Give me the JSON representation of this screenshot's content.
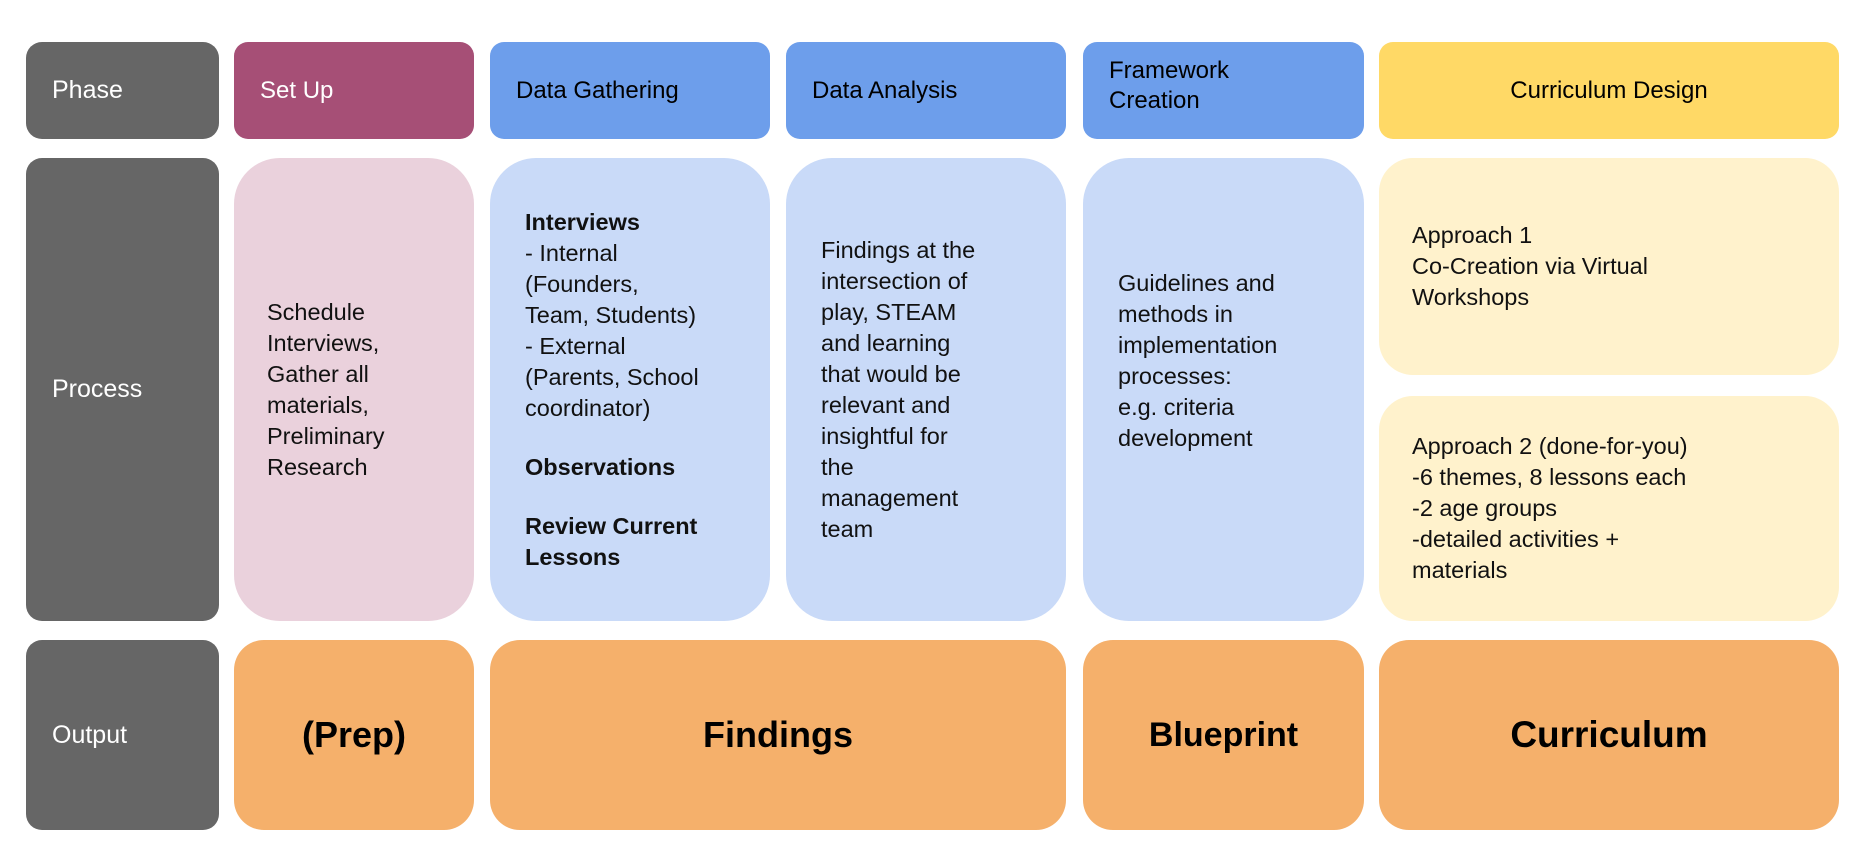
{
  "colors": {
    "label": "#666666",
    "setup": "#A64F76",
    "blue_header": "#6D9EEB",
    "yellow_header": "#FFD966",
    "setup_light": "#EAD1DC",
    "blue_light": "#C9DAF8",
    "yellow_light": "#FFF2CC",
    "output": "#F5B06B"
  },
  "rows": {
    "phase": "Phase",
    "process": "Process",
    "output": "Output"
  },
  "phases": {
    "setup": "Set Up",
    "data_gathering": "Data Gathering",
    "data_analysis": "Data Analysis",
    "framework_creation": "Framework\nCreation",
    "curriculum_design": "Curriculum Design"
  },
  "process": {
    "setup": "Schedule\nInterviews,\nGather all\nmaterials,\nPreliminary\nResearch",
    "data_gathering": {
      "interviews_title": "Interviews",
      "interviews_body": "- Internal\n(Founders,\nTeam, Students)\n- External\n(Parents, School\ncoordinator)",
      "observations": "Observations",
      "review": "Review Current\nLessons"
    },
    "data_analysis": "Findings at the\nintersection of\nplay, STEAM\nand learning\nthat would be\nrelevant and\ninsightful for\nthe\nmanagement\nteam",
    "framework_creation": "Guidelines and\nmethods in\nimplementation\nprocesses:\ne.g. criteria\ndevelopment",
    "curriculum_approach_1": "Approach 1\nCo-Creation via Virtual\nWorkshops",
    "curriculum_approach_2": "Approach 2 (done-for-you)\n-6 themes, 8 lessons each\n-2 age groups\n-detailed activities +\nmaterials"
  },
  "outputs": {
    "setup": "(Prep)",
    "findings": "Findings",
    "blueprint": "Blueprint",
    "curriculum": "Curriculum"
  }
}
